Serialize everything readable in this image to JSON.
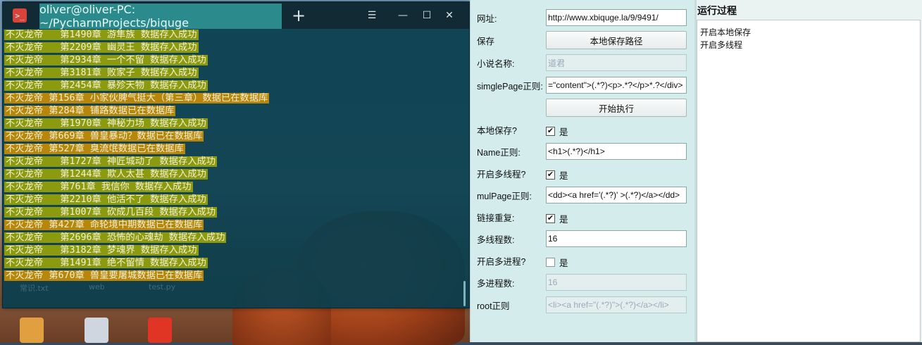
{
  "terminal": {
    "title": "oliver@oliver-PC: ~/PycharmProjects/biquge",
    "new_tab": "+",
    "menu_icon": "hamburger-icon",
    "minimize_icon": "minimize-icon",
    "maximize_icon": "maximize-icon",
    "close_icon": "close-icon",
    "lines": [
      {
        "text": "不灭龙帝   第1490章 游隼族 数据存入成功",
        "color": "green"
      },
      {
        "text": "不灭龙帝   第2209章 幽灵王 数据存入成功",
        "color": "green"
      },
      {
        "text": "不灭龙帝   第2934章 一个不留 数据存入成功",
        "color": "green"
      },
      {
        "text": "不灭龙帝   第3181章 败家子 数据存入成功",
        "color": "green"
      },
      {
        "text": "不灭龙帝   第2454章 暴殄天物 数据存入成功",
        "color": "green"
      },
      {
        "text": "不灭龙帝 第156章 小家伙脾气挺大（第三章）数据已在数据库",
        "color": "orange"
      },
      {
        "text": "不灭龙帝 第284章 铺路数据已在数据库",
        "color": "orange"
      },
      {
        "text": "不灭龙帝   第1970章 神秘力场 数据存入成功",
        "color": "green"
      },
      {
        "text": "不灭龙帝 第669章 兽皇暴动？数据已在数据库",
        "color": "orange"
      },
      {
        "text": "不灭龙帝 第527章 臭流氓数据已在数据库",
        "color": "orange"
      },
      {
        "text": "不灭龙帝   第1727章 神匠城动了 数据存入成功",
        "color": "green"
      },
      {
        "text": "不灭龙帝   第1244章 欺人太甚 数据存入成功",
        "color": "green"
      },
      {
        "text": "不灭龙帝   第761章 我信你 数据存入成功",
        "color": "green"
      },
      {
        "text": "不灭龙帝   第2210章 他活不了 数据存入成功",
        "color": "green"
      },
      {
        "text": "不灭龙帝   第1007章 砍成几百段 数据存入成功",
        "color": "green"
      },
      {
        "text": "不灭龙帝 第427章 命轮境中期数据已在数据库",
        "color": "orange"
      },
      {
        "text": "不灭龙帝   第2696章 恐怖的心魂劫 数据存入成功",
        "color": "green"
      },
      {
        "text": "不灭龙帝   第3182章 梦魂界 数据存入成功",
        "color": "green"
      },
      {
        "text": "不灭龙帝   第1491章 绝不留情 数据存入成功",
        "color": "green"
      },
      {
        "text": "不灭龙帝 第670章 兽皇要屠城数据已在数据库",
        "color": "orange"
      }
    ],
    "ghost_files": [
      "常识.txt",
      "web",
      "test.py"
    ]
  },
  "form": {
    "url_label": "网址:",
    "url_value": "http://www.xbiquge.la/9/9491/",
    "save_label": "保存",
    "save_path_button": "本地保存路径",
    "novel_name_label": "小说名称:",
    "novel_name_placeholder": "道君",
    "single_page_label": "simglePage正则:",
    "single_page_value": "=\"content\">(.*?)<p>.*?</p>*.?</div>",
    "start_button": "开始执行",
    "local_save_label": "本地保存?",
    "local_save_checked": true,
    "yes": "是",
    "name_regex_label": "Name正则:",
    "name_regex_value": "<h1>(.*?)</h1>",
    "multithread_label": "开启多线程?",
    "multithread_checked": true,
    "mul_page_label": "mulPage正则:",
    "mul_page_value": "<dd><a href='(.*?)' >(.*?)</a></dd>",
    "dup_link_label": "链接重复:",
    "dup_link_checked": true,
    "thread_count_label": "多线程数:",
    "thread_count_value": "16",
    "multiprocess_label": "开启多进程?",
    "multiprocess_checked": false,
    "process_count_label": "多进程数:",
    "process_count_placeholder": "16",
    "root_regex_label": "root正则",
    "root_regex_placeholder": "<li><a href=\"(.*?)\">(.*?)</a></li>"
  },
  "log": {
    "title": "运行过程",
    "lines": [
      "开启本地保存",
      "开启多线程"
    ]
  },
  "colors": {
    "terminal_bg": "#0a3e4e",
    "green_highlight": "#8c9a10",
    "orange_highlight": "#b8860b",
    "panel_bg": "#d4ecec"
  }
}
